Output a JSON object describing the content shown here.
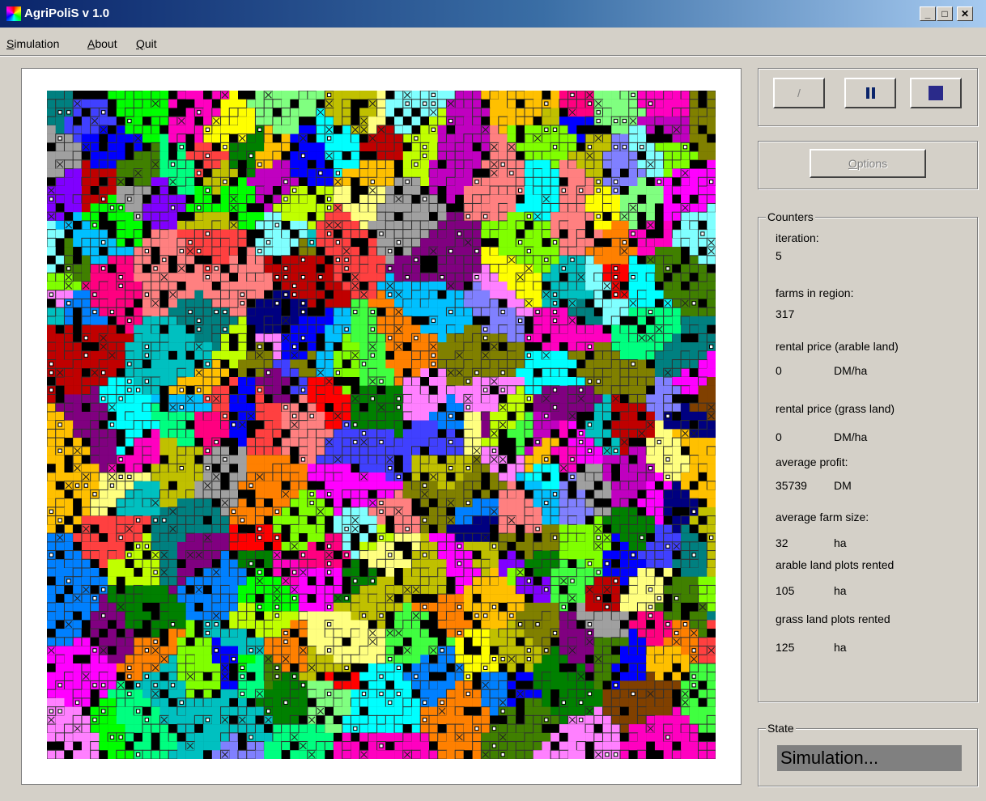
{
  "window": {
    "title": "AgriPoliS v 1.0"
  },
  "menu": {
    "items": [
      {
        "label": "Simulation",
        "mnemonic": "S",
        "rest": "imulation"
      },
      {
        "label": "About",
        "mnemonic": "A",
        "rest": "bout"
      },
      {
        "label": "Quit",
        "mnemonic": "Q",
        "rest": "uit"
      }
    ]
  },
  "controls": {
    "play_icon": "pencil-icon",
    "pause_icon": "pause-icon",
    "stop_icon": "stop-icon",
    "options_label": "Options",
    "options_mnemonic": "O",
    "options_rest": "ptions"
  },
  "counters": {
    "legend": "Counters",
    "iteration_label": "iteration:",
    "iteration_value": "5",
    "farms_label": "farms in region:",
    "farms_value": "317",
    "rent_arable_label": "rental price (arable land)",
    "rent_arable_value": "0",
    "rent_arable_unit": "DM/ha",
    "rent_grass_label": "rental price (grass land)",
    "rent_grass_value": "0",
    "rent_grass_unit": "DM/ha",
    "avg_profit_label": "average profit:",
    "avg_profit_value": "35739",
    "avg_profit_unit": "DM",
    "avg_size_label": "average farm size:",
    "avg_size_value": "32",
    "avg_size_unit": "ha",
    "arable_rented_label": "arable land plots rented",
    "arable_rented_value": "105",
    "arable_rented_unit": "ha",
    "grass_rented_label": "grass land plots rented",
    "grass_rented_value": "125",
    "grass_rented_unit": "ha"
  },
  "state": {
    "legend": "State",
    "value": "Simulation..."
  },
  "map_palette": [
    "#000000",
    "#ff00ff",
    "#00ffff",
    "#ff0000",
    "#00ff00",
    "#0000ff",
    "#ffff00",
    "#ff8000",
    "#8000ff",
    "#00ff80",
    "#ff0080",
    "#80ff00",
    "#0080ff",
    "#c00000",
    "#008000",
    "#000080",
    "#808000",
    "#800080",
    "#008080",
    "#ff80ff",
    "#80ffff",
    "#ffff80",
    "#ff8080",
    "#80ff80",
    "#8080ff",
    "#c0c000",
    "#c000c0",
    "#00c0c0",
    "#804000",
    "#408000",
    "#ff4040",
    "#40ff40",
    "#4040ff",
    "#ffc000",
    "#c0ff00",
    "#00c0ff",
    "#ff00c0",
    "#a0a0a0",
    "#ffffff"
  ]
}
